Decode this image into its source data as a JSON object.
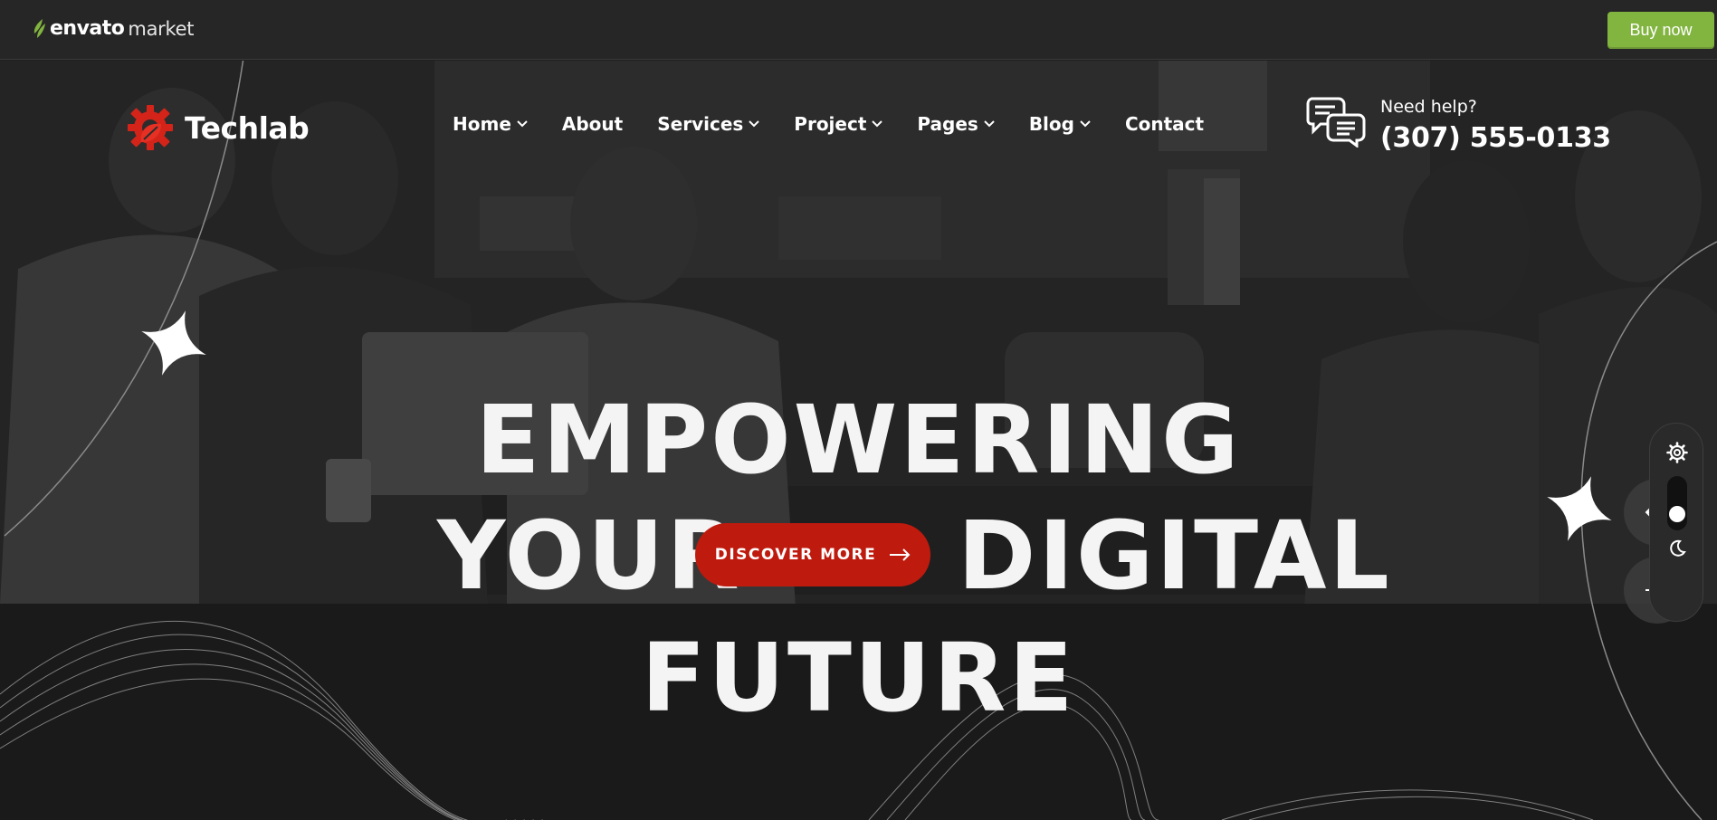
{
  "envato_bar": {
    "brand_word": "envato",
    "brand_suffix": "market",
    "buy_now_label": "Buy now",
    "accent_color": "#82b440"
  },
  "header": {
    "brand_name": "Techlab",
    "brand_icon": "gear-leaf-logo-icon",
    "nav": [
      {
        "label": "Home",
        "dropdown": true
      },
      {
        "label": "About",
        "dropdown": false
      },
      {
        "label": "Services",
        "dropdown": true
      },
      {
        "label": "Project",
        "dropdown": true
      },
      {
        "label": "Pages",
        "dropdown": true
      },
      {
        "label": "Blog",
        "dropdown": true
      },
      {
        "label": "Contact",
        "dropdown": false
      }
    ],
    "help": {
      "icon": "chat-bubbles-icon",
      "label": "Need help?",
      "phone": "(307) 555-0133"
    }
  },
  "hero": {
    "line1": "EMPOWERING",
    "line2_left": "YOUR",
    "line2_right": "DIGITAL",
    "line3": "FUTURE",
    "cta_label": "DISCOVER MORE",
    "cta_color": "#bf1a0e"
  },
  "controls": {
    "settings_icon": "gear-icon",
    "theme_mode": "dark",
    "dark_mode_icon": "moon-icon",
    "prev_icon": "arrow-left-icon",
    "next_icon": "arrow-right-icon"
  }
}
